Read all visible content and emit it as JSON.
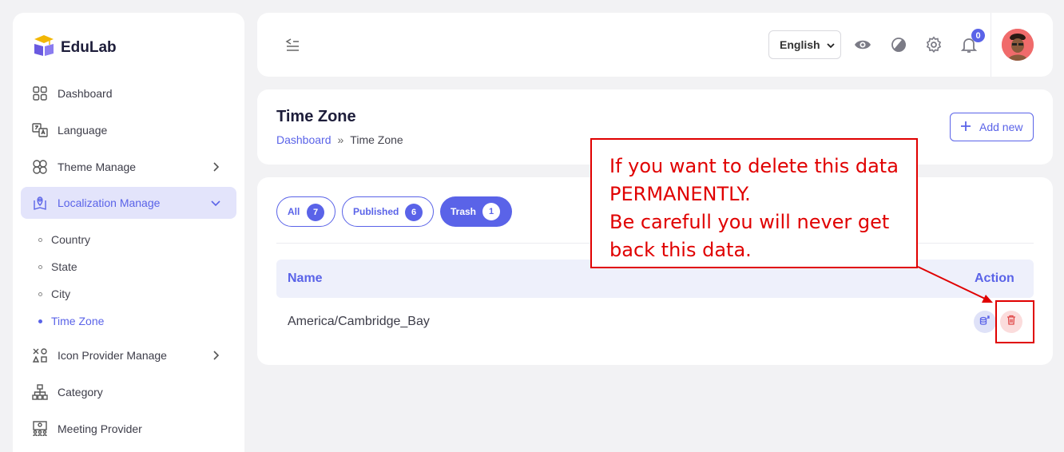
{
  "brand": {
    "name": "EduLab"
  },
  "sidebar": {
    "items": [
      {
        "label": "Dashboard",
        "icon": "grid-icon"
      },
      {
        "label": "Language",
        "icon": "translate-icon"
      },
      {
        "label": "Theme Manage",
        "icon": "shapes-icon"
      },
      {
        "label": "Localization Manage",
        "icon": "map-pin-icon"
      },
      {
        "label": "Icon Provider Manage",
        "icon": "icons-icon"
      },
      {
        "label": "Category",
        "icon": "hierarchy-icon"
      },
      {
        "label": "Meeting Provider",
        "icon": "meeting-icon"
      }
    ],
    "sub_items": [
      {
        "label": "Country"
      },
      {
        "label": "State"
      },
      {
        "label": "City"
      },
      {
        "label": "Time Zone"
      }
    ]
  },
  "topbar": {
    "language": "English",
    "notification_count": "0"
  },
  "page": {
    "title": "Time Zone",
    "breadcrumb": {
      "home": "Dashboard",
      "separator": "»",
      "current": "Time Zone"
    },
    "add_button": "Add new"
  },
  "tabs": [
    {
      "label": "All",
      "count": "7"
    },
    {
      "label": "Published",
      "count": "6"
    },
    {
      "label": "Trash",
      "count": "1"
    }
  ],
  "table": {
    "headers": {
      "name": "Name",
      "action": "Action"
    },
    "rows": [
      {
        "name": "America/Cambridge_Bay"
      }
    ]
  },
  "annotation": {
    "lines": [
      "If you want to delete this data",
      "PERMANENTLY.",
      "Be carefull you will never get",
      "back this data."
    ]
  },
  "colors": {
    "accent": "#5a63e8",
    "danger": "#e00000",
    "active_bg": "#e3e4fb"
  }
}
